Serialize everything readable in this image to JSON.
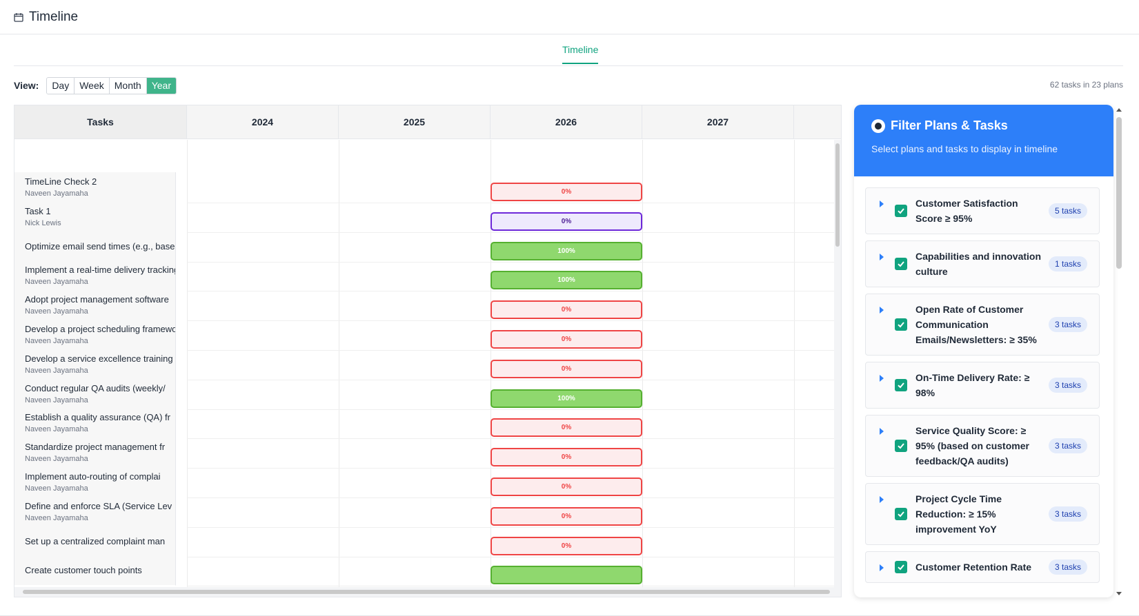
{
  "header": {
    "title": "Timeline",
    "icon": "calendar-icon"
  },
  "tabs": [
    {
      "label": "Timeline",
      "active": true
    }
  ],
  "view": {
    "label": "View:",
    "options": [
      "Day",
      "Week",
      "Month",
      "Year"
    ],
    "selected": "Year",
    "summary": "62 tasks in 23 plans"
  },
  "gantt": {
    "tasks_header": "Tasks",
    "years": [
      "2024",
      "2025",
      "2026",
      "2027"
    ],
    "rows": [
      {
        "name": "TimeLine Check 2",
        "owner": "Naveen Jayamaha",
        "progress": "0%",
        "status": "red"
      },
      {
        "name": "Task 1",
        "owner": "Nick Lewis",
        "progress": "0%",
        "status": "purple"
      },
      {
        "name": "Optimize email send times (e.g., based",
        "owner": "",
        "progress": "100%",
        "status": "green"
      },
      {
        "name": "Implement a real-time delivery tracking",
        "owner": "Naveen Jayamaha",
        "progress": "100%",
        "status": "green"
      },
      {
        "name": "Adopt project management software",
        "owner": "Naveen Jayamaha",
        "progress": "0%",
        "status": "red"
      },
      {
        "name": "Develop a project scheduling framework",
        "owner": "Naveen Jayamaha",
        "progress": "0%",
        "status": "red"
      },
      {
        "name": "Develop a service excellence training",
        "owner": "Naveen Jayamaha",
        "progress": "0%",
        "status": "red"
      },
      {
        "name": "Conduct regular QA audits (weekly/",
        "owner": "Naveen Jayamaha",
        "progress": "100%",
        "status": "green"
      },
      {
        "name": "Establish a quality assurance (QA) fr",
        "owner": "Naveen Jayamaha",
        "progress": "0%",
        "status": "red"
      },
      {
        "name": "Standardize project management fr",
        "owner": "Naveen Jayamaha",
        "progress": "0%",
        "status": "red"
      },
      {
        "name": "Implement auto-routing of complai",
        "owner": "Naveen Jayamaha",
        "progress": "0%",
        "status": "red"
      },
      {
        "name": "Define and enforce SLA (Service Lev",
        "owner": "Naveen Jayamaha",
        "progress": "0%",
        "status": "red"
      },
      {
        "name": "Set up a centralized complaint man",
        "owner": "",
        "progress": "0%",
        "status": "red"
      },
      {
        "name": "Create customer touch points",
        "owner": "",
        "progress": "",
        "status": "green"
      }
    ]
  },
  "filter": {
    "title": "Filter Plans & Tasks",
    "subtitle": "Select plans and tasks to display in timeline",
    "plans": [
      {
        "label": "Customer Satisfaction Score ≥ 95%",
        "count": "5 tasks",
        "checked": true
      },
      {
        "label": "Capabilities and innovation culture",
        "count": "1 tasks",
        "checked": true
      },
      {
        "label": "Open Rate of Customer Communication Emails/Newsletters: ≥ 35%",
        "count": "3 tasks",
        "checked": true
      },
      {
        "label": "On-Time Delivery Rate: ≥ 98%",
        "count": "3 tasks",
        "checked": true
      },
      {
        "label": "Service Quality Score: ≥ 95% (based on customer feedback/QA audits)",
        "count": "3 tasks",
        "checked": true
      },
      {
        "label": "Project Cycle Time Reduction: ≥ 15% improvement YoY",
        "count": "3 tasks",
        "checked": true
      },
      {
        "label": "Customer Retention Rate",
        "count": "3 tasks",
        "checked": true
      }
    ]
  },
  "colors": {
    "accent": "#10a37f",
    "filter_header": "#2d7ff9",
    "bar_red": "#ef4444",
    "bar_green": "#8fd86e",
    "bar_purple": "#6d28d9"
  }
}
